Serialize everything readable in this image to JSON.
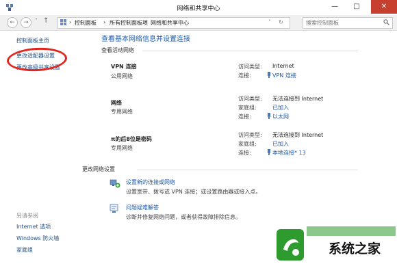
{
  "window": {
    "title": "网络和共享中心"
  },
  "address": {
    "crumbs": [
      "控制面板",
      "所有控制面板项",
      "网络和共享中心"
    ],
    "search_placeholder": "搜索控制面板"
  },
  "sidebar": {
    "links": [
      "控制面板主页",
      "更改适配器设置",
      "更改高级共享设置"
    ],
    "see_also_heading": "另请参阅",
    "see_also": [
      "Internet 选项",
      "Windows 防火墙",
      "家庭组"
    ]
  },
  "main": {
    "heading": "查看基本网络信息并设置连接",
    "active_label": "查看活动网络",
    "networks": [
      {
        "name": "VPN 连接",
        "category": "公用网络",
        "access_label": "访问类型:",
        "access_value": "Internet",
        "conn_label": "连接:",
        "conn_value": "VPN 连接"
      },
      {
        "name": "网络",
        "category": "专用网络",
        "access_label": "访问类型:",
        "access_value": "无法连接到 Internet",
        "home_label": "家庭组:",
        "home_value": "已加入",
        "conn_label": "连接:",
        "conn_value": "以太网"
      },
      {
        "name": "π的后8位是密码",
        "category": "专用网络",
        "access_label": "访问类型:",
        "access_value": "无法连接到 Internet",
        "home_label": "家庭组:",
        "home_value": "已加入",
        "conn_label": "连接:",
        "conn_value": "本地连接* 13"
      }
    ],
    "change_label": "更改网络设置",
    "tasks": [
      {
        "title": "设置新的连接或网络",
        "desc": "设置宽带、拨号或 VPN 连接；或设置路由器或接入点。"
      },
      {
        "title": "问题疑难解答",
        "desc": "诊断并修复网络问题，或者获得故障排除信息。"
      }
    ]
  },
  "watermark": {
    "text": "系统之家"
  },
  "colors": {
    "link": "#1e5aa8",
    "close": "#c7402f",
    "annotation": "#e0261f",
    "watermark_green": "#2e9b2e"
  }
}
